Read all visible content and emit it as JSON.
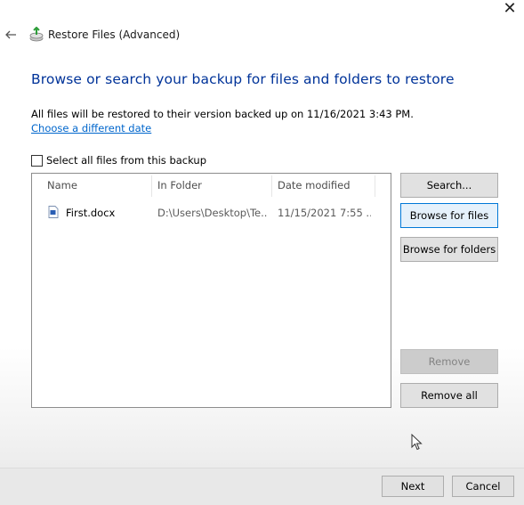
{
  "window": {
    "title": "Restore Files (Advanced)",
    "close_icon": "close-icon",
    "back_icon": "back-arrow-icon",
    "app_icon": "backup-restore-icon"
  },
  "main": {
    "heading": "Browse or search your backup for files and folders to restore",
    "info": "All files will be restored to their version backed up on 11/16/2021 3:43 PM.",
    "change_date_link": "Choose a different date",
    "select_all_label": "Select all files from this backup",
    "select_all_checked": false
  },
  "list": {
    "columns": [
      "Name",
      "In Folder",
      "Date modified"
    ],
    "rows": [
      {
        "icon": "word-document-icon",
        "name": "First.docx",
        "folder": "D:\\Users\\Desktop\\Te...",
        "date": "11/15/2021 7:55 ..."
      }
    ]
  },
  "side_buttons": {
    "search": "Search...",
    "browse_files": "Browse for files",
    "browse_folders": "Browse for folders",
    "remove": "Remove",
    "remove_all": "Remove all"
  },
  "footer": {
    "next": "Next",
    "cancel": "Cancel"
  },
  "colors": {
    "heading": "#003399",
    "link": "#0066cc",
    "focus_border": "#0078d7"
  }
}
